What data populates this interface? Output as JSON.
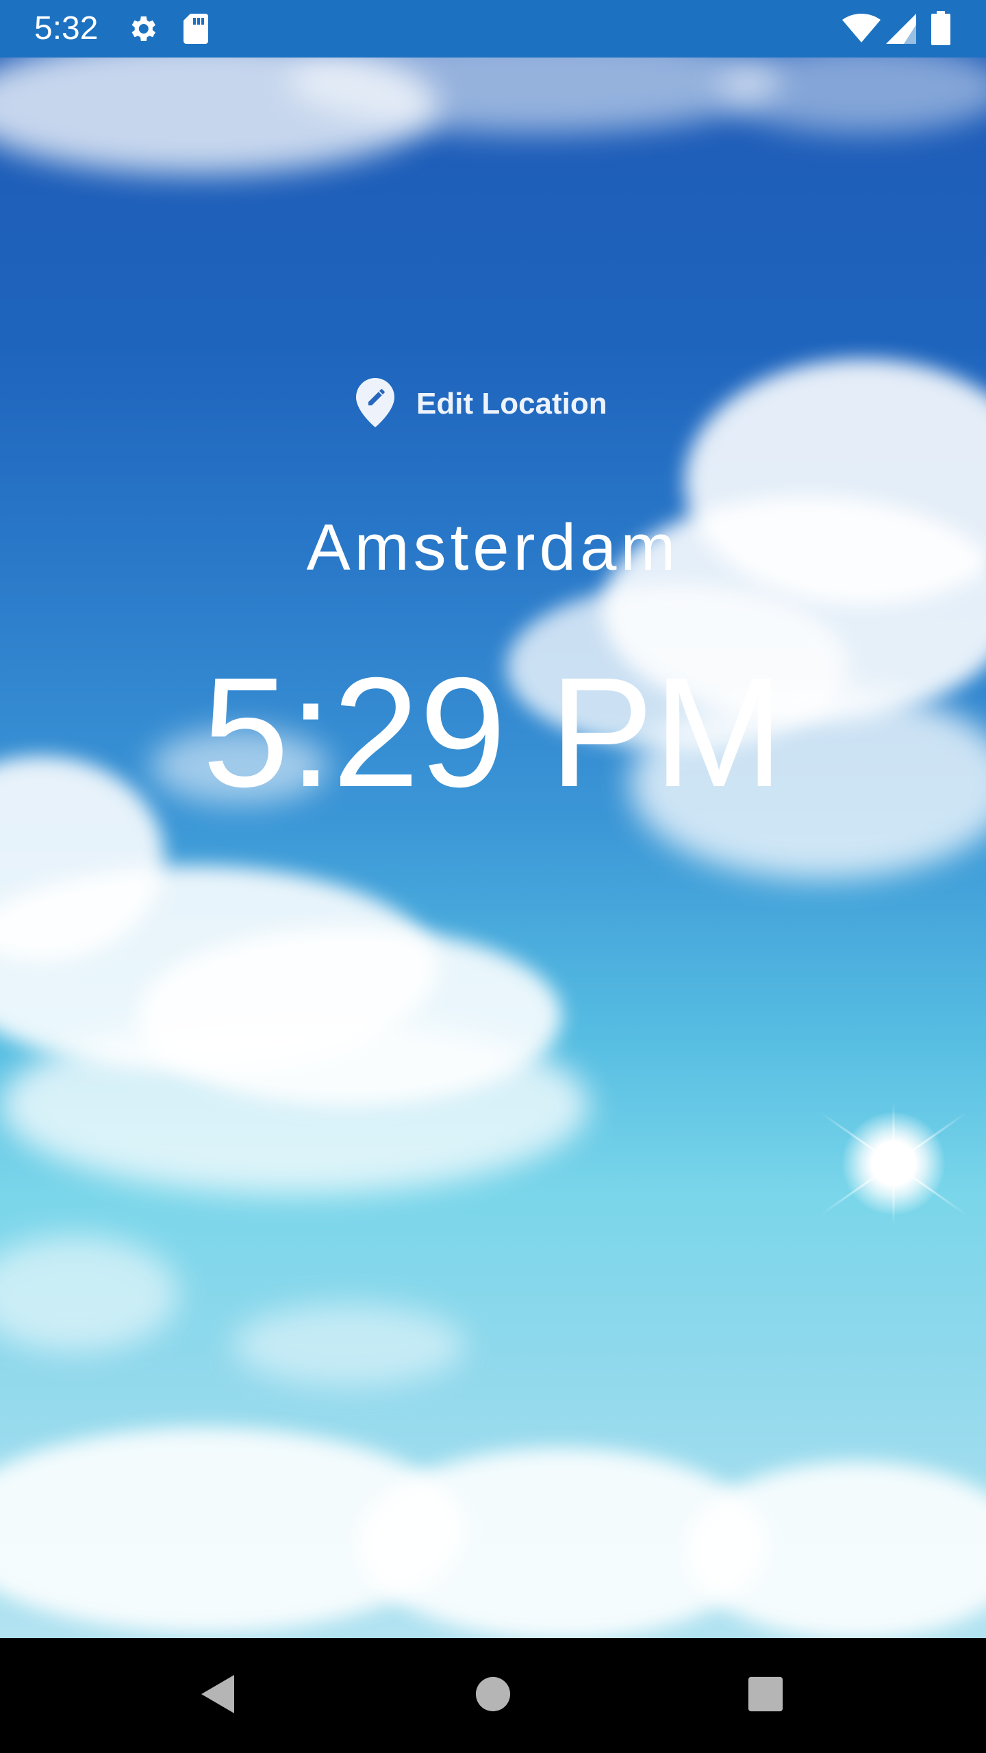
{
  "status_bar": {
    "time": "5:32",
    "icons": [
      "gear-icon",
      "sd-card-icon",
      "wifi-icon",
      "signal-icon",
      "battery-icon"
    ]
  },
  "main": {
    "edit_location_label": "Edit Location",
    "edit_location_icon": "location-pin-edit-icon",
    "city": "Amsterdam",
    "time": "5:29 PM",
    "background": "sky-with-clouds-and-sun"
  },
  "nav_bar": {
    "buttons": [
      "back-icon",
      "home-icon",
      "recents-icon"
    ]
  },
  "colors": {
    "status_bar": "#1c72c1",
    "nav_bar": "#000000",
    "text": "#ffffff",
    "sky_top": "#1f5bb7",
    "sky_bottom": "#b2e3f1"
  }
}
